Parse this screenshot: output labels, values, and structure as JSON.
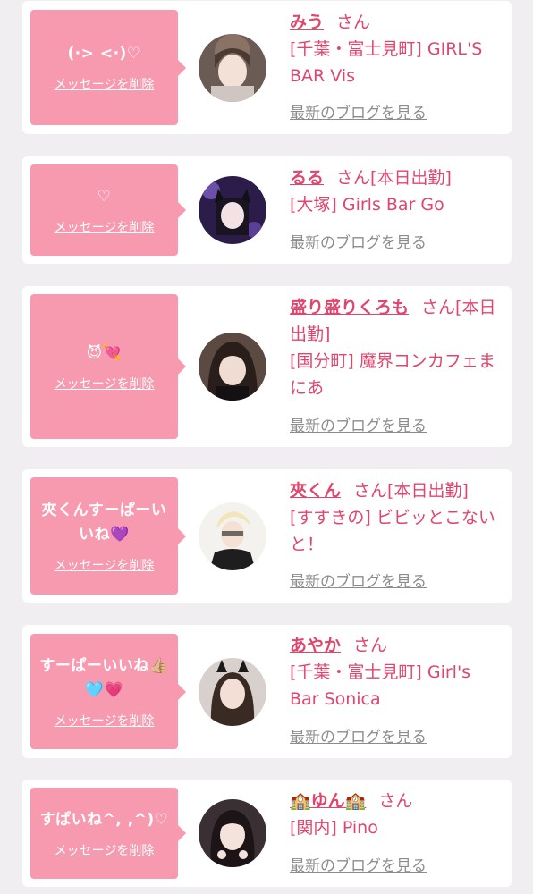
{
  "delete_label": "メッセージを削除",
  "blog_label": "最新のブログを見る",
  "honorific": "さん",
  "colors": {
    "accent": "#e0466d",
    "bubble": "#f79ab0",
    "card": "#ffffff",
    "background": "#f0eef0",
    "link_gray": "#8c8c8c"
  },
  "messages": [
    {
      "text": "(·> <·)♡",
      "name": "みう",
      "status": "",
      "shop": "[千葉・富士見町] GIRL'S BAR Vis"
    },
    {
      "text": "♡",
      "name": "るる",
      "status": "[本日出勤]",
      "shop": "[大塚] Girls Bar Go"
    },
    {
      "text": "😈💘",
      "name": "盛り盛りくろも",
      "status": "[本日出勤]",
      "shop": "[国分町] 魔界コンカフェまにあ"
    },
    {
      "text": "夾くんすーぱーいいね💜",
      "name": "夾くん",
      "status": "[本日出勤]",
      "shop": "[すすきの] ビビッとこないと！"
    },
    {
      "text": "すーぱーいいね👍🏼🩵💗",
      "name": "あやか",
      "status": "",
      "shop": "[千葉・富士見町] Girl's Bar Sonica"
    },
    {
      "text": "すぱいね^, ,^)♡",
      "name": "🏫ゆん🏫",
      "status": "",
      "shop": "[関内] Pino"
    }
  ]
}
